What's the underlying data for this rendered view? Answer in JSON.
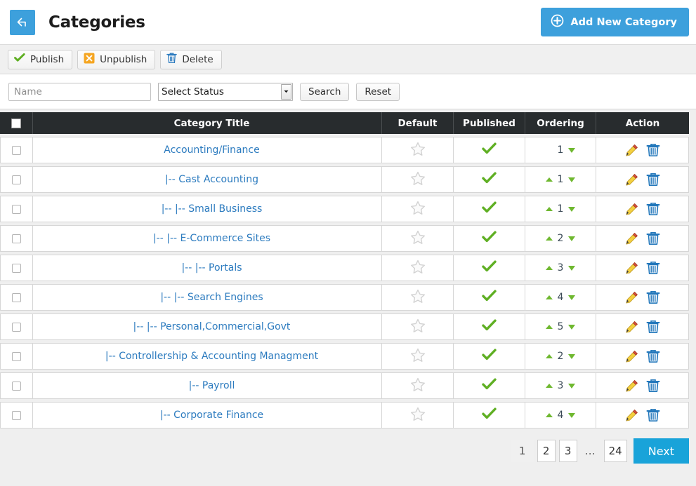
{
  "header": {
    "title": "Categories",
    "back_icon": "back-arrow-icon",
    "add_button_label": "Add New Category",
    "add_button_icon": "plus-circle-icon",
    "accent_color": "#3da0dc"
  },
  "toolbar": {
    "buttons": [
      {
        "label": "Publish",
        "icon": "green-check-icon",
        "color": "#6fb830"
      },
      {
        "label": "Unpublish",
        "icon": "orange-x-icon",
        "color": "#f5a623"
      },
      {
        "label": "Delete",
        "icon": "blue-trash-icon",
        "color": "#2c7bbf"
      }
    ]
  },
  "filter": {
    "name_placeholder": "Name",
    "name_value": "",
    "status_selected": "Select Status",
    "status_options": [
      "Select Status"
    ],
    "search_label": "Search",
    "reset_label": "Reset"
  },
  "table": {
    "columns": [
      "",
      "Category Title",
      "Default",
      "Published",
      "Ordering",
      "Action"
    ],
    "header_bg": "#282c2e",
    "select_all_checked": false,
    "rows": [
      {
        "checked": false,
        "title": "Accounting/Finance",
        "default_starred": false,
        "published": true,
        "ordering": "1",
        "can_move_up": false,
        "can_move_down": true
      },
      {
        "checked": false,
        "title": "|-- Cast Accounting",
        "default_starred": false,
        "published": true,
        "ordering": "1",
        "can_move_up": true,
        "can_move_down": true
      },
      {
        "checked": false,
        "title": "|-- |-- Small Business",
        "default_starred": false,
        "published": true,
        "ordering": "1",
        "can_move_up": true,
        "can_move_down": true
      },
      {
        "checked": false,
        "title": "|-- |-- E-Commerce Sites",
        "default_starred": false,
        "published": true,
        "ordering": "2",
        "can_move_up": true,
        "can_move_down": true
      },
      {
        "checked": false,
        "title": "|-- |-- Portals",
        "default_starred": false,
        "published": true,
        "ordering": "3",
        "can_move_up": true,
        "can_move_down": true
      },
      {
        "checked": false,
        "title": "|-- |-- Search Engines",
        "default_starred": false,
        "published": true,
        "ordering": "4",
        "can_move_up": true,
        "can_move_down": true
      },
      {
        "checked": false,
        "title": "|-- |-- Personal,Commercial,Govt",
        "default_starred": false,
        "published": true,
        "ordering": "5",
        "can_move_up": true,
        "can_move_down": true
      },
      {
        "checked": false,
        "title": "|-- Controllership & Accounting Managment",
        "default_starred": false,
        "published": true,
        "ordering": "2",
        "can_move_up": true,
        "can_move_down": true
      },
      {
        "checked": false,
        "title": "|-- Payroll",
        "default_starred": false,
        "published": true,
        "ordering": "3",
        "can_move_up": true,
        "can_move_down": true
      },
      {
        "checked": false,
        "title": "|-- Corporate Finance",
        "default_starred": false,
        "published": true,
        "ordering": "4",
        "can_move_up": true,
        "can_move_down": true
      }
    ],
    "row_icons": {
      "default_icon": "star-outline-icon",
      "published_icon": "green-check-icon",
      "edit_icon": "pencil-icon",
      "delete_icon": "blue-trash-icon"
    }
  },
  "pagination": {
    "pages": [
      "1",
      "2",
      "3",
      "…",
      "24"
    ],
    "active_page": "1",
    "next_label": "Next",
    "next_color": "#19a3d9"
  }
}
